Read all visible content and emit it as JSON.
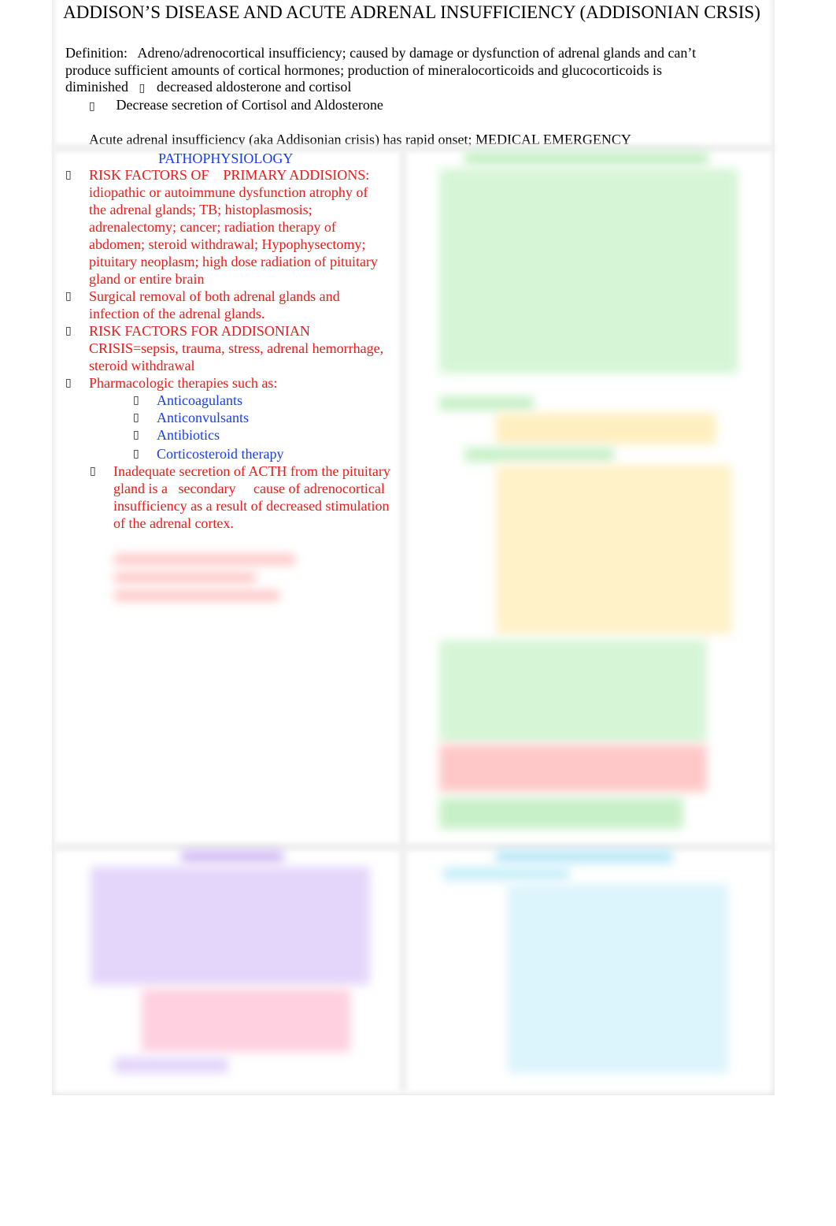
{
  "document": {
    "title": "ADDISON’S DISEASE AND ACUTE ADRENAL INSUFFICIENCY (ADDISONIAN CRSIS)",
    "definition_label": "Definition:",
    "definition_text": "Adreno/adrenocortical insufficiency; caused by damage or dysfunction of adrenal glands and can’t produce sufficient amounts of cortical hormones; production of mineralocorticoids and glucocorticoids is diminished",
    "definition_arrow_text": "decreased aldosterone and cortisol",
    "bullet_glyph": "▯",
    "sub_bullet": "Decrease secretion of Cortisol and Aldosterone",
    "crisis_note": "Acute adrenal insufficiency (aka Addisonian crisis) has rapid onset; MEDICAL EMERGENCY"
  },
  "pathophysiology": {
    "heading": "PATHOPHYSIOLOGY",
    "items": [
      {
        "label": "RISK FACTORS OF",
        "label2": "PRIMARY ADDISIONS:",
        "text": "idiopathic or autoimmune dysfunction atrophy of the adrenal glands; TB; histoplasmosis; adrenalectomy; cancer; radiation therapy of abdomen; steroid withdrawal; Hypophysectomy; pituitary neoplasm; high dose radiation of pituitary gland or entire brain"
      },
      {
        "text": "Surgical removal of both adrenal glands and infection of the adrenal glands."
      },
      {
        "text": "RISK FACTORS FOR ADDISONIAN CRISIS=sepsis, trauma, stress, adrenal hemorrhage, steroid withdrawal"
      },
      {
        "text": "Pharmacologic therapies such as:"
      }
    ],
    "drugs": [
      "Anticoagulants",
      "Anticonvulsants",
      "Antibiotics",
      "Corticosteroid therapy"
    ],
    "secondary": {
      "before": "Inadequate secretion of ACTH from the pituitary gland is a",
      "keyword": "secondary",
      "after": "cause of adrenocortical insufficiency as a result of decreased stimulation of the adrenal cortex."
    }
  },
  "colors": {
    "blue": "#1a3cf0",
    "red": "#f01818",
    "blurred_green": "#c8f0c8",
    "blurred_yellow": "#ffe9a8",
    "blurred_red": "#ffb4b4",
    "blurred_purple": "#d6c2f5",
    "blurred_cyan": "#bfeaf8"
  }
}
